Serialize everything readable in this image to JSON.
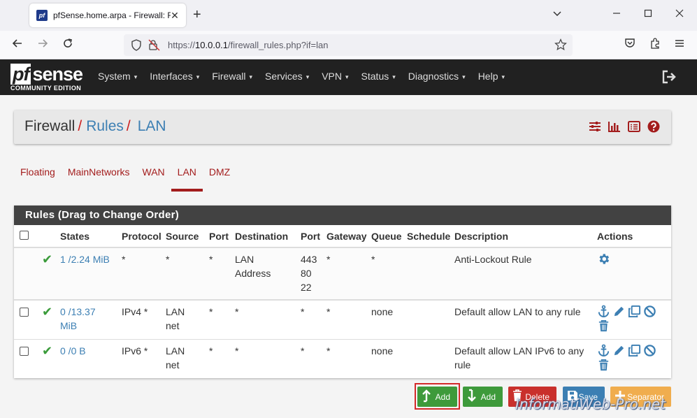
{
  "browser": {
    "tab_title": "pfSense.home.arpa - Firewall: R",
    "tab_favicon_text": "pf",
    "url_prefix": "https://",
    "url_host": "10.0.0.1",
    "url_path": "/firewall_rules.php?if=lan"
  },
  "pfsense": {
    "logo_pf": "pf",
    "logo_sense": "sense",
    "edition": "COMMUNITY EDITION",
    "menu": [
      "System",
      "Interfaces",
      "Firewall",
      "Services",
      "VPN",
      "Status",
      "Diagnostics",
      "Help"
    ],
    "menu_caret": "▾"
  },
  "breadcrumb": {
    "first": "Firewall",
    "sep": "/",
    "second": "Rules",
    "third": "LAN"
  },
  "subtabs": [
    "Floating",
    "MainNetworks",
    "WAN",
    "LAN",
    "DMZ"
  ],
  "active_subtab": "LAN",
  "panel_title": "Rules (Drag to Change Order)",
  "table": {
    "headers": [
      "States",
      "Protocol",
      "Source",
      "Port",
      "Destination",
      "Port",
      "Gateway",
      "Queue",
      "Schedule",
      "Description",
      "Actions"
    ],
    "rows": [
      {
        "states_line1": "1 /2.24 MiB",
        "states_line2": "",
        "protocol": "*",
        "source_line1": "*",
        "source_line2": "",
        "sport": "*",
        "dest_line1": "LAN",
        "dest_line2": "Address",
        "dport_line1": "443",
        "dport_line2": "80",
        "dport_line3": "22",
        "gateway": "*",
        "queue": "*",
        "schedule": "",
        "desc_line1": "Anti-Lockout Rule",
        "desc_line2": ""
      },
      {
        "states_line1": "0 /13.37",
        "states_line2": "MiB",
        "protocol": "IPv4 *",
        "source_line1": "LAN",
        "source_line2": "net",
        "sport": "*",
        "dest_line1": "*",
        "dest_line2": "",
        "dport_line1": "*",
        "dport_line2": "",
        "dport_line3": "",
        "gateway": "*",
        "queue": "none",
        "schedule": "",
        "desc_line1": "Default allow LAN to any rule",
        "desc_line2": ""
      },
      {
        "states_line1": "0 /0 B",
        "states_line2": "",
        "protocol": "IPv6 *",
        "source_line1": "LAN",
        "source_line2": "net",
        "sport": "*",
        "dest_line1": "*",
        "dest_line2": "",
        "dport_line1": "*",
        "dport_line2": "",
        "dport_line3": "",
        "gateway": "*",
        "queue": "none",
        "schedule": "",
        "desc_line1": "Default allow LAN IPv6 to any",
        "desc_line2": "rule"
      }
    ]
  },
  "buttons": {
    "add_top": "Add",
    "add_bottom": "Add",
    "delete": "Delete",
    "save": "Save",
    "separator": "Separator"
  },
  "watermark": "InformatiWeb-Pro.net",
  "colors": {
    "pf_red": "#a31d1d",
    "link_blue": "#3c7fb3",
    "navbar_dark": "#212121",
    "success_green": "#3e9a3b"
  }
}
